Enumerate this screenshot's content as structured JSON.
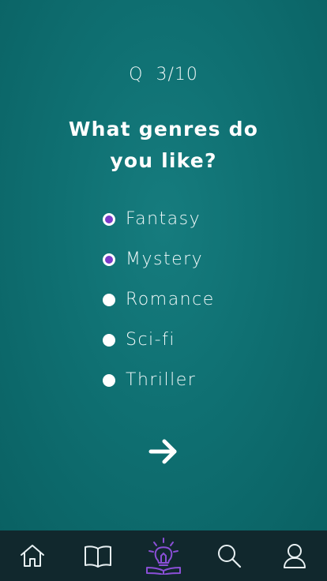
{
  "quiz": {
    "progress_label": "Q  3/10",
    "question": "What genres do you like?",
    "options": [
      {
        "label": "Fantasy",
        "selected": true
      },
      {
        "label": "Mystery",
        "selected": true
      },
      {
        "label": "Romance",
        "selected": false
      },
      {
        "label": "Sci-fi",
        "selected": false
      },
      {
        "label": "Thriller",
        "selected": false
      }
    ],
    "next_icon": "arrow-right-icon"
  },
  "tabbar": {
    "items": [
      {
        "icon": "home-icon",
        "active": false
      },
      {
        "icon": "book-icon",
        "active": false
      },
      {
        "icon": "lightbulb-icon",
        "active": true
      },
      {
        "icon": "search-icon",
        "active": false
      },
      {
        "icon": "user-icon",
        "active": false
      }
    ]
  },
  "colors": {
    "background": "#0e6a6c",
    "accent": "#7a3bc7",
    "tabbar": "#11282d",
    "tab_active": "#8a4fd6"
  }
}
